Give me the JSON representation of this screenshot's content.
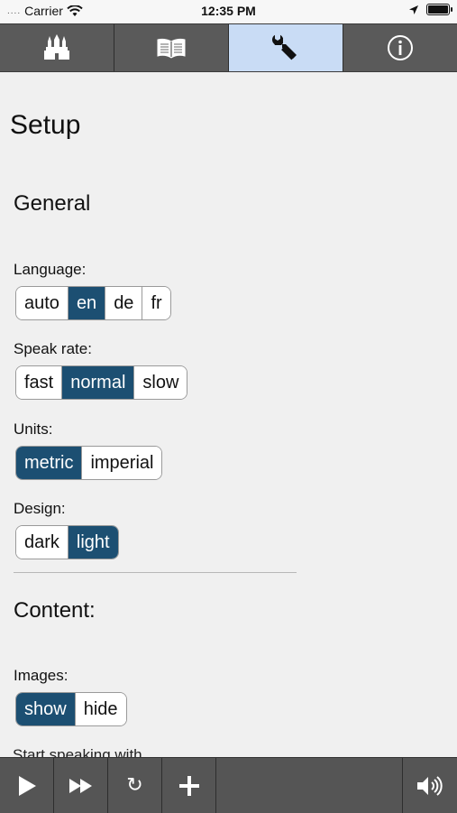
{
  "status_bar": {
    "dots": "....",
    "carrier": "Carrier",
    "time": "12:35 PM"
  },
  "tabs": [
    {
      "icon": "castle-icon",
      "active": false
    },
    {
      "icon": "book-icon",
      "active": false
    },
    {
      "icon": "wrench-icon",
      "active": true
    },
    {
      "icon": "info-icon",
      "active": false
    }
  ],
  "page": {
    "title": "Setup",
    "general_title": "General",
    "language": {
      "label": "Language:",
      "options": [
        "auto",
        "en",
        "de",
        "fr"
      ],
      "selected": "en"
    },
    "speak_rate": {
      "label": "Speak rate:",
      "options": [
        "fast",
        "normal",
        "slow"
      ],
      "selected": "normal"
    },
    "units": {
      "label": "Units:",
      "options": [
        "metric",
        "imperial"
      ],
      "selected": "metric"
    },
    "design": {
      "label": "Design:",
      "options": [
        "dark",
        "light"
      ],
      "selected": "light"
    },
    "content_title": "Content:",
    "images": {
      "label": "Images:",
      "options": [
        "show",
        "hide"
      ],
      "selected": "show"
    },
    "start_speaking_label": "Start speaking with"
  },
  "toolbar": {
    "buttons": [
      "play-icon",
      "fast-forward-icon",
      "refresh-icon",
      "plus-icon",
      "volume-icon"
    ],
    "refresh_glyph": "↻"
  },
  "colors": {
    "selected_segment": "#1c4f72",
    "active_tab": "#c9dcf5",
    "bar_background": "#555555"
  }
}
